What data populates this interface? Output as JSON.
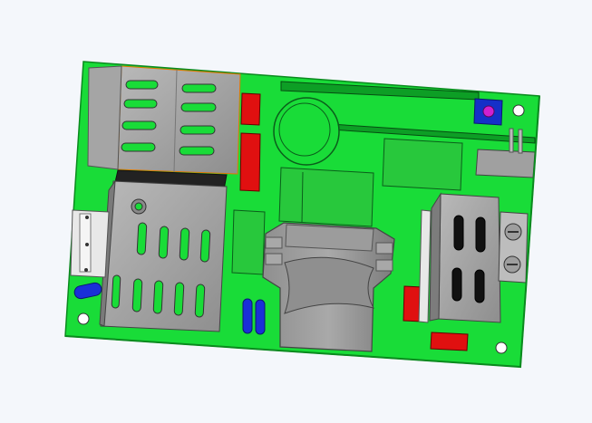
{
  "viewport": {
    "background": "#f4f7fb"
  },
  "model": {
    "type": "pcb-assembly-3d-view",
    "colors": {
      "board": "#19dc38",
      "board_edge": "#0a8a1e",
      "metal": "#9a9a9a",
      "metal_dark": "#6e6e6e",
      "metal_light": "#c8c8c8",
      "capacitor_red": "#e01010",
      "y_cap_blue": "#1a2fd8",
      "trimpot_blue": "#1530c8",
      "trimpot_magenta": "#d020d0",
      "transformer_green": "#28c83c",
      "mounting_hole": "#ffffff"
    },
    "parts": [
      "heatsink-top-left",
      "heatsink-bottom-left",
      "heatsink-right",
      "transformer",
      "bulk-capacitor",
      "input-connector",
      "output-terminal-block",
      "trimpot",
      "y-capacitors",
      "film-capacitors",
      "mounting-holes"
    ]
  }
}
